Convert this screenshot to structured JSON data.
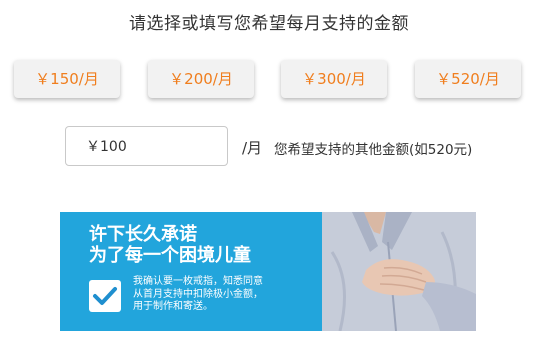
{
  "title": "请选择或填写您希望每月支持的金额",
  "amount_options": [
    "￥150/月",
    "￥200/月",
    "￥300/月",
    "￥520/月"
  ],
  "custom_amount": {
    "value": "￥100",
    "unit": "/月",
    "hint": "您希望支持的其他金额(如520元)"
  },
  "banner": {
    "headline_line1": "许下长久承诺",
    "headline_line2": "为了每一个困境儿童",
    "agreement_line1": "我确认要一枚戒指，知悉同意",
    "agreement_line2": "从首月支持中扣除极小金额，",
    "agreement_line3": "用于制作和寄送。",
    "checkbox_checked": true
  },
  "colors": {
    "accent": "#f07e1e",
    "banner_blue": "#22a5dc",
    "check_blue": "#1f8fcf"
  },
  "icons": {
    "checkbox": "check-icon"
  }
}
